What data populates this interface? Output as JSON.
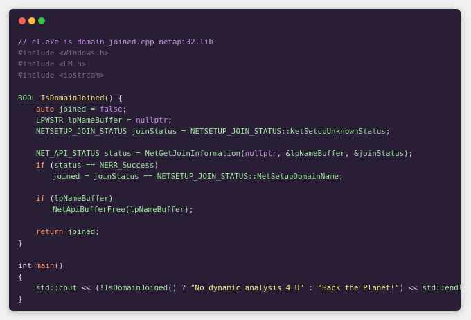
{
  "theme": {
    "comment": "#c792ea",
    "preproc": "#7a6a87",
    "type": "#9fe89f",
    "func": "#f2e37a",
    "keyword": "#ff9b69",
    "builtin": "#c792ea",
    "plain": "#dcdcdc",
    "string": "#f5ea7f",
    "window_dots": [
      "#ff5f57",
      "#febc2e",
      "#28c840"
    ]
  },
  "code_lines": [
    [
      {
        "t": "// cl.exe is_domain_joined.cpp netapi32.lib",
        "c": "comment"
      }
    ],
    [
      {
        "t": "#include <Windows.h>",
        "c": "preproc"
      }
    ],
    [
      {
        "t": "#include <LM.h>",
        "c": "preproc"
      }
    ],
    [
      {
        "t": "#include <iostream>",
        "c": "preproc"
      }
    ],
    [],
    [
      {
        "t": "BOOL ",
        "c": "type"
      },
      {
        "t": "IsDomainJoined",
        "c": "func"
      },
      {
        "t": "() {",
        "c": "plain"
      }
    ],
    [
      {
        "t": "auto ",
        "c": "keyword"
      },
      {
        "t": "joined = ",
        "c": "type"
      },
      {
        "t": "false",
        "c": "builtin"
      },
      {
        "t": ";",
        "c": "plain"
      }
    ],
    [
      {
        "t": "LPWSTR lpNameBuffer = ",
        "c": "type"
      },
      {
        "t": "nullptr",
        "c": "builtin"
      },
      {
        "t": ";",
        "c": "plain"
      }
    ],
    [
      {
        "t": "NETSETUP_JOIN_STATUS joinStatus = NETSETUP_JOIN_STATUS::NetSetupUnknownStatus",
        "c": "type"
      },
      {
        "t": ";",
        "c": "plain"
      }
    ],
    [],
    [
      {
        "t": "NET_API_STATUS status = NetGetJoinInformation(",
        "c": "type"
      },
      {
        "t": "nullptr",
        "c": "builtin"
      },
      {
        "t": ", &",
        "c": "plain"
      },
      {
        "t": "lpNameBuffer",
        "c": "type"
      },
      {
        "t": ", &",
        "c": "plain"
      },
      {
        "t": "joinStatus",
        "c": "type"
      },
      {
        "t": ");",
        "c": "plain"
      }
    ],
    [
      {
        "t": "if ",
        "c": "keyword"
      },
      {
        "t": "(",
        "c": "plain"
      },
      {
        "t": "status == NERR_Success",
        "c": "type"
      },
      {
        "t": ")",
        "c": "plain"
      }
    ],
    [
      {
        "t": "joined = joinStatus == NETSETUP_JOIN_STATUS::NetSetupDomainName",
        "c": "type"
      },
      {
        "t": ";",
        "c": "plain"
      }
    ],
    [],
    [
      {
        "t": "if ",
        "c": "keyword"
      },
      {
        "t": "(",
        "c": "plain"
      },
      {
        "t": "lpNameBuffer",
        "c": "type"
      },
      {
        "t": ")",
        "c": "plain"
      }
    ],
    [
      {
        "t": "NetApiBufferFree(lpNameBuffer",
        "c": "type"
      },
      {
        "t": ");",
        "c": "plain"
      }
    ],
    [],
    [
      {
        "t": "return ",
        "c": "keyword"
      },
      {
        "t": "joined",
        "c": "type"
      },
      {
        "t": ";",
        "c": "plain"
      }
    ],
    [
      {
        "t": "}",
        "c": "plain"
      }
    ],
    [],
    [
      {
        "t": "int ",
        "c": "plain"
      },
      {
        "t": "main",
        "c": "keyword"
      },
      {
        "t": "()",
        "c": "plain"
      }
    ],
    [
      {
        "t": "{",
        "c": "plain"
      }
    ],
    [
      {
        "t": "std::cout ",
        "c": "type"
      },
      {
        "t": "<< (!",
        "c": "plain"
      },
      {
        "t": "IsDomainJoined",
        "c": "type"
      },
      {
        "t": "() ? ",
        "c": "plain"
      },
      {
        "t": "\"No dynamic analysis 4 U\"",
        "c": "string"
      },
      {
        "t": " : ",
        "c": "plain"
      },
      {
        "t": "\"Hack the Planet!\"",
        "c": "string"
      },
      {
        "t": ") << ",
        "c": "plain"
      },
      {
        "t": "std::endl",
        "c": "type"
      },
      {
        "t": ";",
        "c": "plain"
      }
    ],
    [
      {
        "t": "}",
        "c": "plain"
      }
    ]
  ],
  "indent_levels": [
    0,
    0,
    0,
    0,
    0,
    0,
    1,
    1,
    1,
    0,
    1,
    1,
    2,
    0,
    1,
    2,
    0,
    1,
    0,
    0,
    0,
    0,
    1,
    0
  ]
}
